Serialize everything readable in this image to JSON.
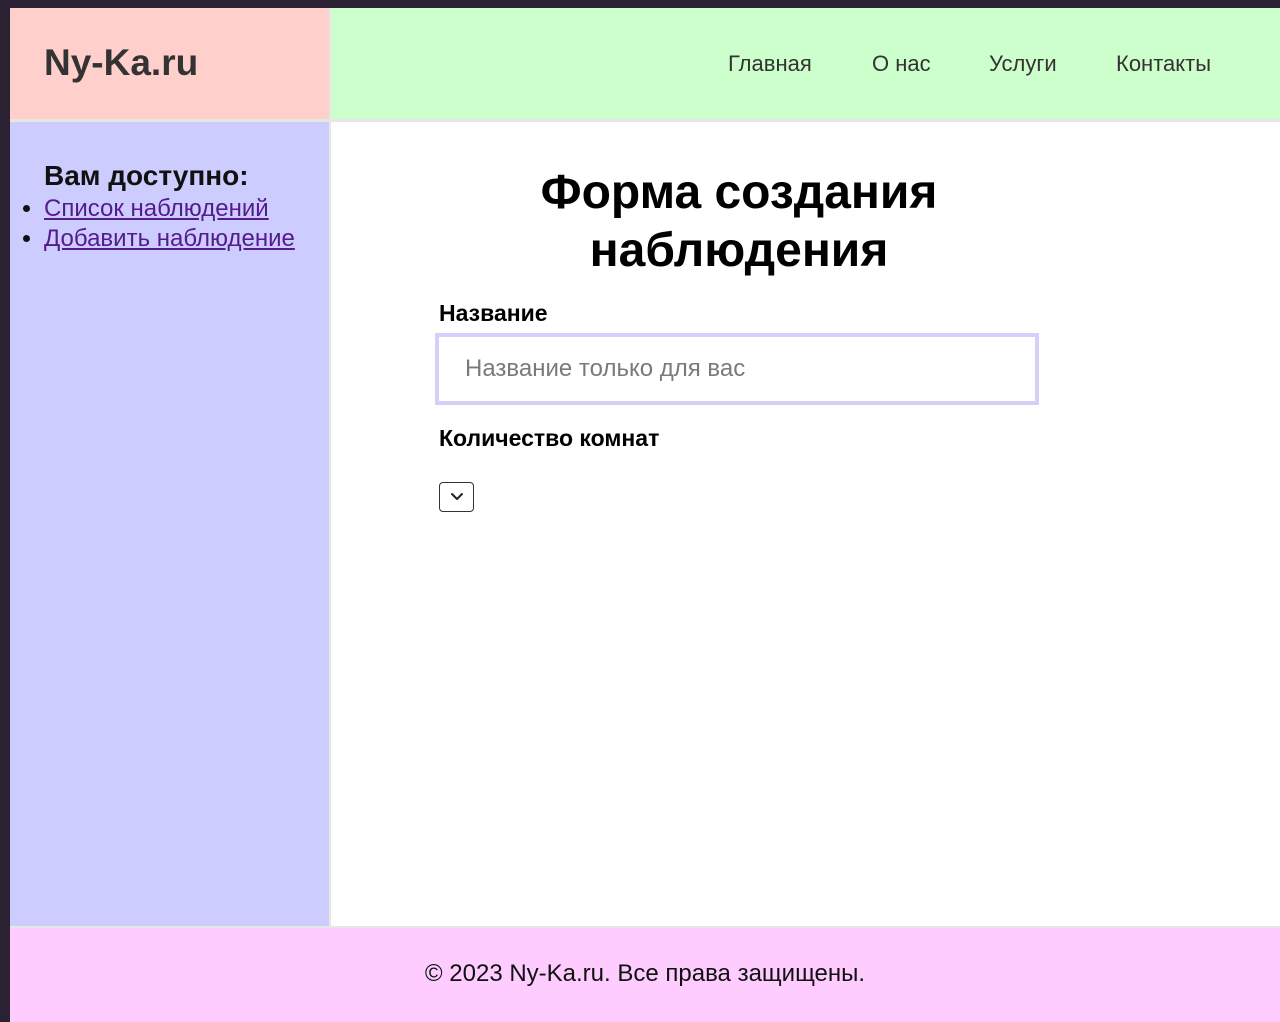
{
  "header": {
    "brand": "Ny-Ka.ru",
    "nav": [
      {
        "label": "Главная"
      },
      {
        "label": "О нас"
      },
      {
        "label": "Услуги"
      },
      {
        "label": "Контакты"
      }
    ]
  },
  "sidebar": {
    "title": "Вам доступно:",
    "items": [
      {
        "label": "Список наблюдений"
      },
      {
        "label": "Добавить наблюдение"
      }
    ]
  },
  "main": {
    "title": "Форма создания наблюдения",
    "name_label": "Название",
    "name_value": "",
    "name_placeholder": "Название только для вас",
    "rooms_label": "Количество комнат",
    "rooms_selected": ""
  },
  "footer": {
    "text": "© 2023 Ny-Ka.ru. Все права защищены."
  },
  "colors": {
    "header_brand_bg": "#ffcfcc",
    "header_nav_bg": "#ccffcc",
    "sidebar_bg": "#ccccff",
    "footer_bg": "#ffccff",
    "input_border": "#d4d0fa",
    "visited_link": "#551a8b"
  },
  "icons": {
    "rooms_select": "chevron-down-icon"
  }
}
